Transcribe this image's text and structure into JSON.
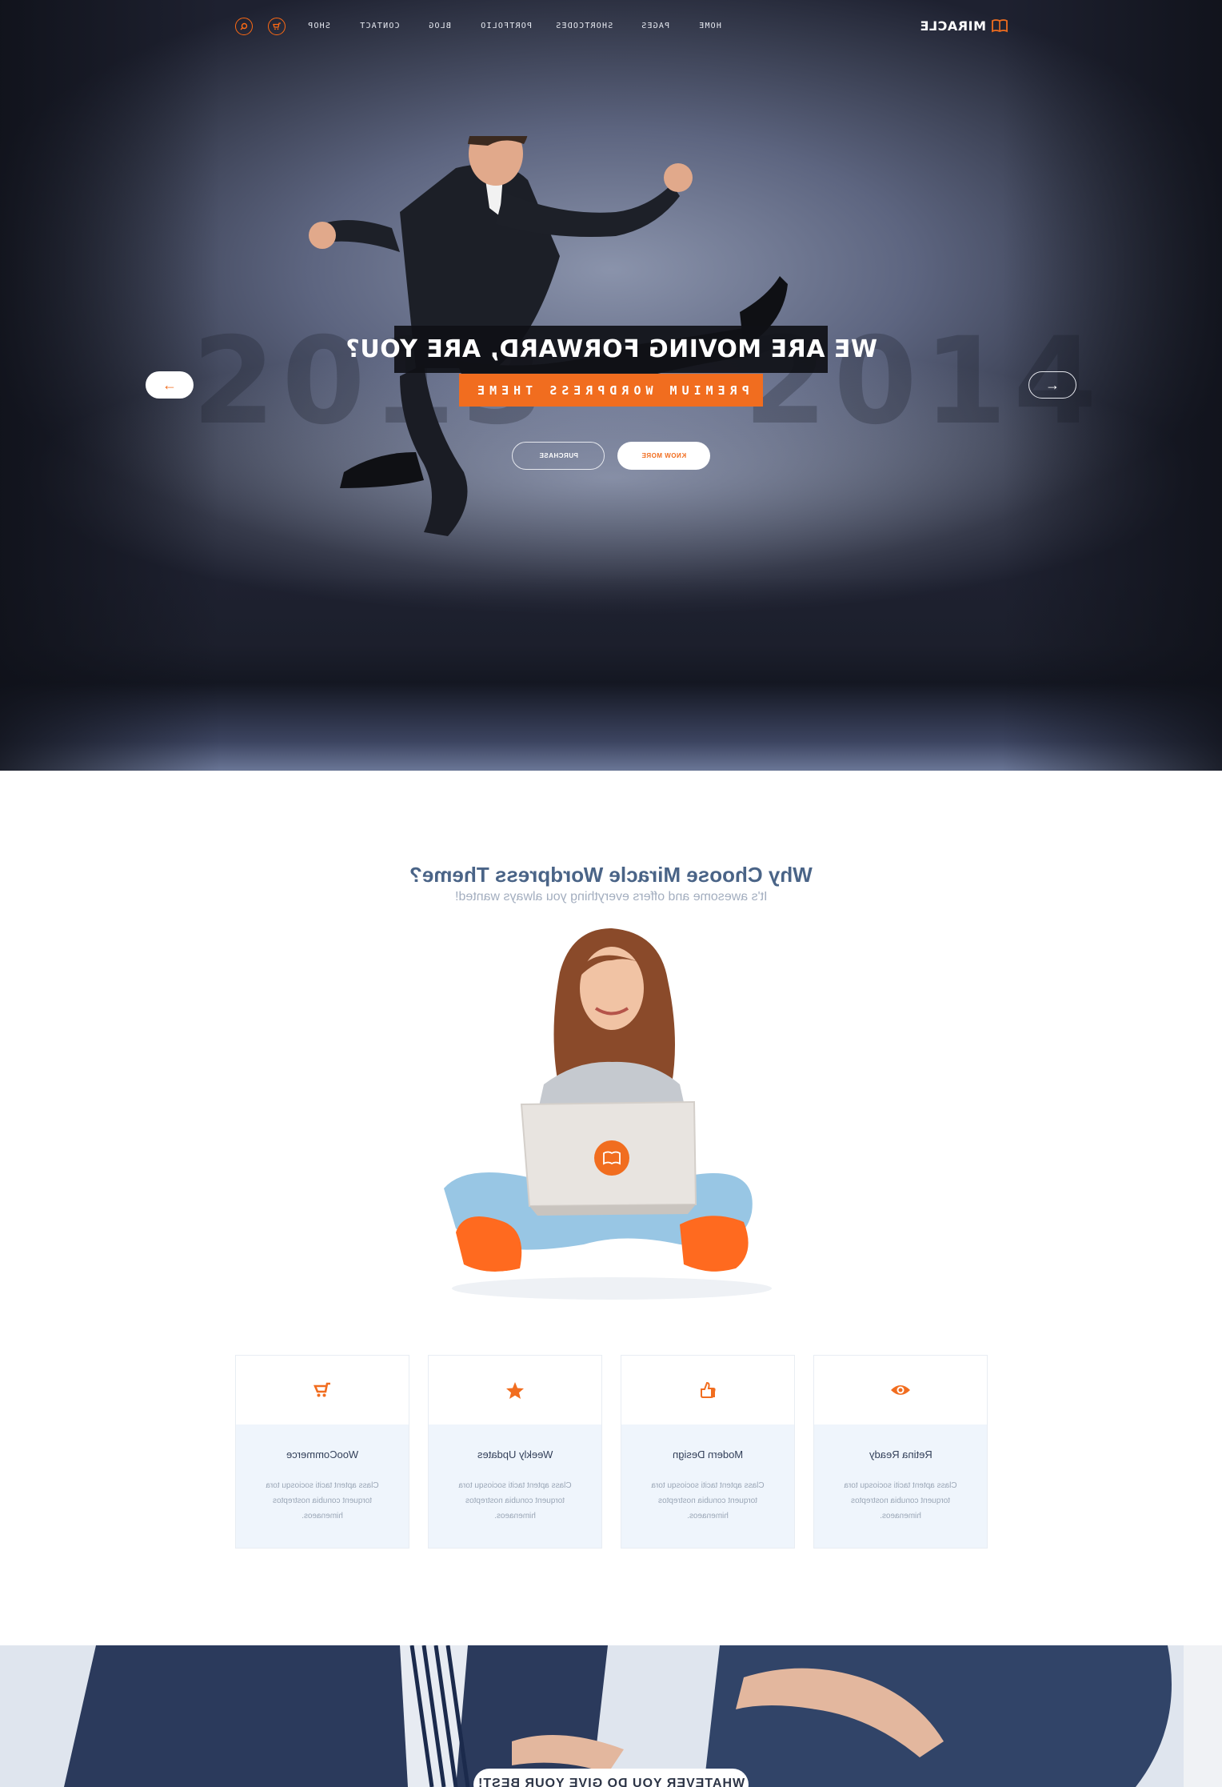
{
  "nav": {
    "brand": "MIRACLE",
    "items": [
      "HOME",
      "PAGES",
      "SHORTCODES",
      "PORTFOLIO",
      "BLOG",
      "CONTACT",
      "SHOP"
    ],
    "search_icon": "search-icon",
    "cart_icon": "cart-icon"
  },
  "hero": {
    "headline": "WE ARE MOVING FORWARD, ARE YOU?",
    "subline": "PREMIUM WORDPRESS THEME",
    "know_more": "KNOW MORE",
    "purchase": "PURCHASE",
    "background_years": [
      "2013",
      "2014"
    ],
    "prev_arrow": "←",
    "next_arrow": "→"
  },
  "why": {
    "title": "Why Choose Miracle Wordpress Theme?",
    "subtitle": "It's awesome and offers everything you always wanted!"
  },
  "features": [
    {
      "icon": "eye-icon",
      "title": "Retina Ready",
      "text": "Class aptent taciti sociosqu tora torquent conubia nostreptos himenaeos."
    },
    {
      "icon": "thumbs-up-icon",
      "title": "Modern Design",
      "text": "Class aptent taciti sociosqu tora torquent conubia nostreptos himenaeos."
    },
    {
      "icon": "star-icon",
      "title": "Weekly Updates",
      "text": "Class aptent taciti sociosqu tora torquent conubia nostreptos himenaeos."
    },
    {
      "icon": "cart-icon",
      "title": "WooCommerce",
      "text": "Class aptent taciti sociosqu tora torquent conubia nostreptos himenaeos."
    }
  ],
  "band": {
    "pill_text": "WHATEVER YOU DO GIVE YOUR BEST!"
  },
  "colors": {
    "accent": "#f16d1f",
    "title_blue": "#4a6487",
    "card_bg": "#eff5fc"
  }
}
